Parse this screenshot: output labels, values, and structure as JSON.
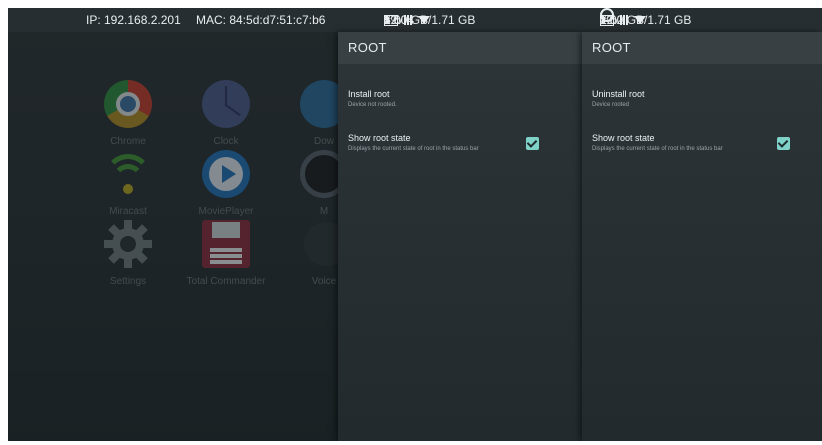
{
  "status_bar": {
    "ip": "IP: 192.168.2.201",
    "mac": "MAC: 84:5d:d7:51:c7:b6",
    "left_panel": {
      "battery": "5%",
      "memory": "1.00 GB/1.71 GB",
      "hash": "#",
      "time": "12:04"
    },
    "right_panel": {
      "battery": "1%",
      "memory": "1.02 GB/1.71 GB",
      "hash": "#",
      "time": "12:0"
    }
  },
  "launcher": {
    "apps": [
      {
        "label": "Chrome",
        "icon": "chrome-icon"
      },
      {
        "label": "Clock",
        "icon": "clock-icon"
      },
      {
        "label": "Dow",
        "icon": "downloads-icon"
      },
      {
        "label": "Miracast",
        "icon": "miracast-icon"
      },
      {
        "label": "MoviePlayer",
        "icon": "movieplayer-icon"
      },
      {
        "label": "M",
        "icon": "music-icon"
      },
      {
        "label": "Settings",
        "icon": "settings-icon"
      },
      {
        "label": "Total Commander",
        "icon": "total-commander-icon"
      },
      {
        "label": "Voice",
        "icon": "voice-icon"
      }
    ]
  },
  "panel_a": {
    "title": "ROOT",
    "pref1": {
      "title": "Install root",
      "summary": "Device not rooted."
    },
    "pref2": {
      "title": "Show root state",
      "summary": "Displays the current state of root in the status bar",
      "checked": true
    }
  },
  "panel_b": {
    "title": "ROOT",
    "pref1": {
      "title": "Uninstall root",
      "summary": "Device rooted"
    },
    "pref2": {
      "title": "Show root state",
      "summary": "Displays the current state of root in the status bar",
      "checked": true
    }
  },
  "colors": {
    "accent": "#7fd2c8",
    "toolbar": "#384044",
    "background": "#273034"
  }
}
